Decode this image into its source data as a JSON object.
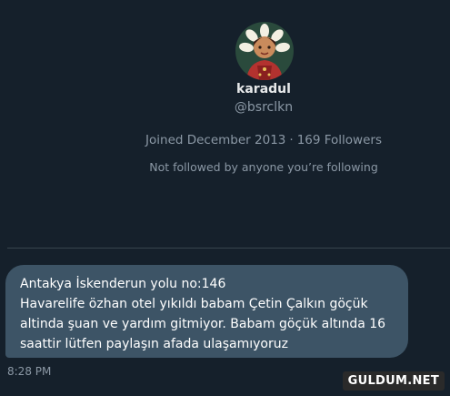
{
  "profile": {
    "display_name": "karadul",
    "handle": "@bsrclkn",
    "joined": "Joined December 2013",
    "separator": "·",
    "followers": "169 Followers",
    "follow_note": "Not followed by anyone you’re following",
    "avatar_icon": "profile-avatar-illustration"
  },
  "message": {
    "lines": [
      "Antakya İskenderun yolu no:146",
      "Havarelife özhan otel yıkıldı babam Çetin Çalkın göçük",
      "altinda şuan ve yardım gitmiyor. Babam göçük altında 16",
      "saattir lütfen paylaşın afada ulaşamıyoruz"
    ],
    "timestamp": "8:28 PM"
  },
  "watermark": "GULDUM.NET",
  "colors": {
    "background": "#15202b",
    "bubble": "#3d5466",
    "secondary_text": "#8b98a5",
    "divider": "#38444d"
  }
}
